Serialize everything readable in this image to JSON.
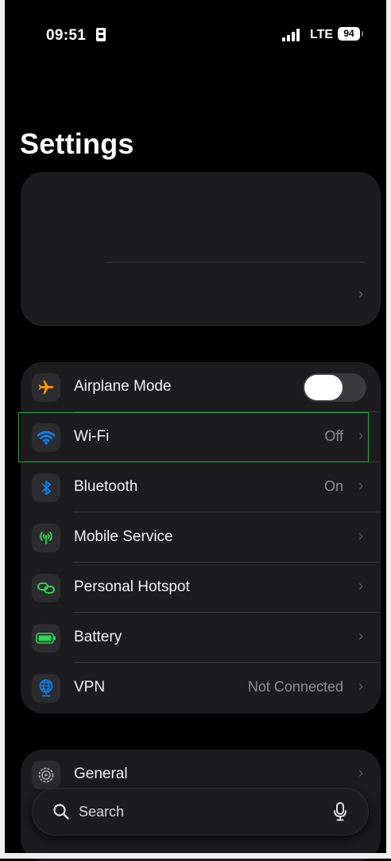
{
  "status_bar": {
    "time": "09:51",
    "network": "LTE",
    "battery": "94"
  },
  "title": "Settings",
  "connectivity": [
    {
      "label": "Airplane Mode",
      "icon": "airplane-icon",
      "icon_color": "#ff9500",
      "toggle": "off"
    },
    {
      "label": "Wi-Fi",
      "value": "Off",
      "icon": "wifi-icon",
      "icon_color": "#0a84ff"
    },
    {
      "label": "Bluetooth",
      "value": "On",
      "icon": "bluetooth-icon",
      "icon_color": "#0a84ff"
    },
    {
      "label": "Mobile Service",
      "value": "",
      "icon": "antenna-icon",
      "icon_color": "#30d158"
    },
    {
      "label": "Personal Hotspot",
      "value": "",
      "icon": "link-icon",
      "icon_color": "#30d158"
    },
    {
      "label": "Battery",
      "value": "",
      "icon": "battery-icon",
      "icon_color": "#30d158"
    },
    {
      "label": "VPN",
      "value": "Not Connected",
      "icon": "globe-icon",
      "icon_color": "#0a84ff"
    }
  ],
  "general": {
    "label": "General",
    "icon": "gear-icon"
  },
  "search": {
    "placeholder": "Search"
  }
}
